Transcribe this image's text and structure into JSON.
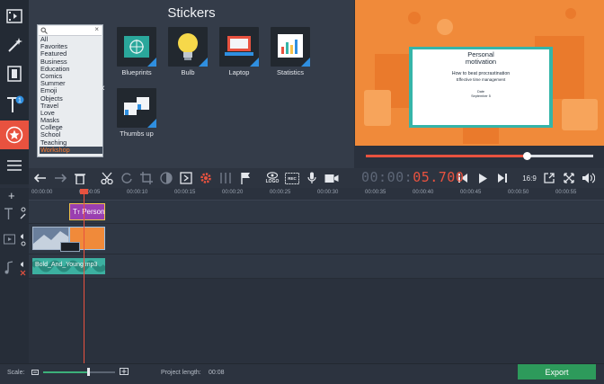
{
  "panel": {
    "title": "Stickers",
    "categories": [
      "All",
      "Favorites",
      "Featured",
      "Business",
      "Education",
      "Comics",
      "Summer",
      "Emoji",
      "Objects",
      "Travel",
      "Love",
      "Masks",
      "College",
      "School",
      "Teaching",
      "Workshop"
    ],
    "selected_category": "Workshop",
    "stickers": [
      {
        "label": "Blueprints",
        "icon": "blueprint-icon"
      },
      {
        "label": "Bulb",
        "icon": "lightbulb-icon"
      },
      {
        "label": "Laptop",
        "icon": "laptop-icon"
      },
      {
        "label": "Statistics",
        "icon": "statistics-icon"
      },
      {
        "label": "Thumbs up",
        "icon": "thumbs-up-icon"
      }
    ]
  },
  "preview": {
    "title": "Personal\nmotivation",
    "line1": "How to beat procrastination",
    "line2": "Effective time management",
    "date_label": "Date",
    "date_value": "September 5",
    "playback_fraction": 0.71
  },
  "toolbar": {
    "logo_label": "LOGO",
    "rec_label": "REC",
    "timecode_dim": "00:00:",
    "timecode_active": "05.700",
    "aspect": "16:9"
  },
  "ruler": [
    "00:00:00",
    "00:00:05",
    "00:00:10",
    "00:00:15",
    "00:00:20",
    "00:00:25",
    "00:00:30",
    "00:00:35",
    "00:00:40",
    "00:00:45",
    "00:00:50",
    "00:00:55"
  ],
  "tracks": {
    "title_clip": "Person",
    "audio_clip": "Bold_And_Young.mp3"
  },
  "footer": {
    "scale_label": "Scale:",
    "project_length_label": "Project length:",
    "project_length_value": "00:08",
    "export_label": "Export"
  },
  "colors": {
    "accent": "#e8523f",
    "export": "#2d9a5b",
    "timecode": "#e8523f",
    "title_clip": "#9a3fb0",
    "video_clip": "#f08a3a",
    "audio_clip": "#3cb0a0"
  }
}
